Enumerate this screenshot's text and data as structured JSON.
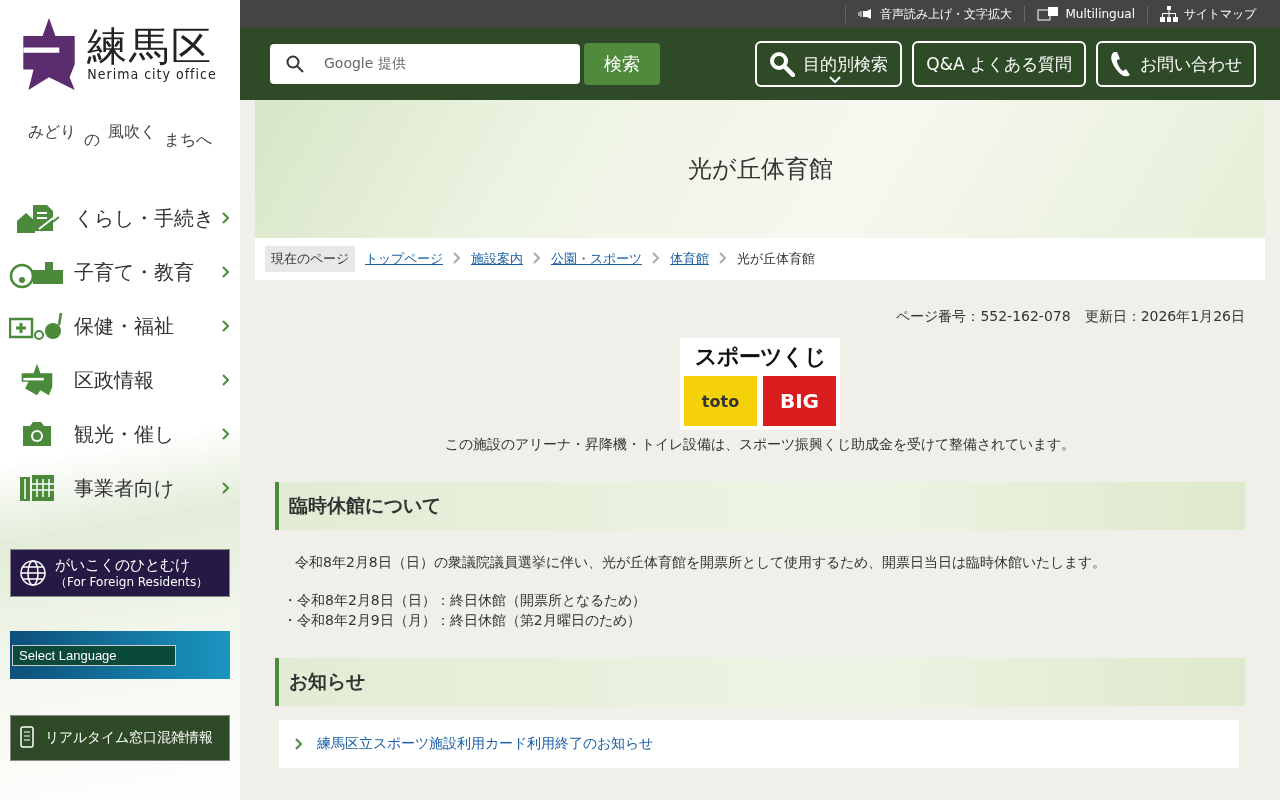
{
  "logo": {
    "name": "練馬区",
    "subtitle": "Nerima city office"
  },
  "slogan": [
    "みどり",
    "の",
    "風吹く",
    "まちへ"
  ],
  "sidebar": {
    "items": [
      {
        "label": "くらし・手続き"
      },
      {
        "label": "子育て・教育"
      },
      {
        "label": "保健・福祉"
      },
      {
        "label": "区政情報"
      },
      {
        "label": "観光・催し"
      },
      {
        "label": "事業者向け"
      }
    ],
    "foreign_banner": {
      "title": "がいこくのひとむけ",
      "subtitle": "（For Foreign Residents）"
    },
    "language_select": {
      "value": "Select Language"
    },
    "realtime_banner": "リアルタイム窓口混雑情報"
  },
  "utility_bar": [
    {
      "label": "音声読み上げ・文字拡大"
    },
    {
      "label": "Multilingual"
    },
    {
      "label": "サイトマップ"
    }
  ],
  "search": {
    "placeholder": "Google 提供",
    "button": "検索"
  },
  "header_buttons": [
    {
      "label": "目的別検索"
    },
    {
      "label": "Q&A よくある質問"
    },
    {
      "label": "お問い合わせ"
    }
  ],
  "page_title": "光が丘体育館",
  "breadcrumb": {
    "label": "現在のページ",
    "items": [
      {
        "text": "トップページ",
        "link": true
      },
      {
        "text": "施設案内",
        "link": true
      },
      {
        "text": "公園・スポーツ",
        "link": true
      },
      {
        "text": "体育館",
        "link": true
      },
      {
        "text": "光が丘体育館",
        "link": false
      }
    ]
  },
  "page_meta": "ページ番号：552-162-078　更新日：2026年1月26日",
  "sports_logo": {
    "title": "スポーツくじ",
    "left": "toto",
    "right": "BIG"
  },
  "grant_note": "この施設のアリーナ・昇降機・トイレ設備は、スポーツ振興くじ助成金を受けて整備されています。",
  "sections": [
    {
      "heading": "臨時休館について",
      "paragraphs": [
        "令和8年2月8日（日）の衆議院議員選挙に伴い、光が丘体育館を開票所として使用するため、開票日当日は臨時休館いたします。"
      ],
      "bullets": [
        "・令和8年2月8日（日）：終日休館（開票所となるため）",
        "・令和8年2月9日（月）：終日休館（第2月曜日のため）"
      ]
    },
    {
      "heading": "お知らせ",
      "links": [
        "練馬区立スポーツ施設利用カード利用終了のお知らせ"
      ]
    }
  ]
}
